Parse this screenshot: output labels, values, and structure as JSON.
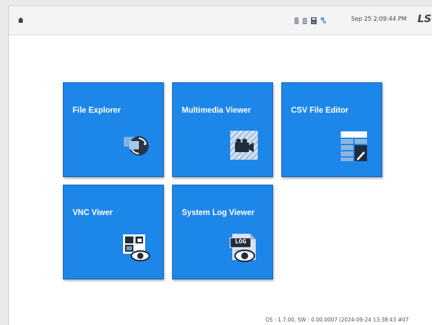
{
  "topbar": {
    "home_icon": "home-icon",
    "status_icons": [
      "storage-icon",
      "memory-icon",
      "save-icon",
      "network-icon"
    ],
    "clock": "Sep 25 2:09:44 PM",
    "logo": "LS"
  },
  "tiles": [
    {
      "label": "File Explorer",
      "icon": "file-explorer-icon"
    },
    {
      "label": "Multimedia Viewer",
      "icon": "multimedia-icon"
    },
    {
      "label": "CSV File Editor",
      "icon": "csv-editor-icon"
    },
    {
      "label": "VNC Viwer",
      "icon": "vnc-viewer-icon"
    },
    {
      "label": "System Log Viewer",
      "icon": "log-viewer-icon"
    }
  ],
  "log_icon_text": "LOG",
  "footer": "OS : 1.7.00, SW : 0.00.0007 (2024-09-24 13:38:43 #07"
}
